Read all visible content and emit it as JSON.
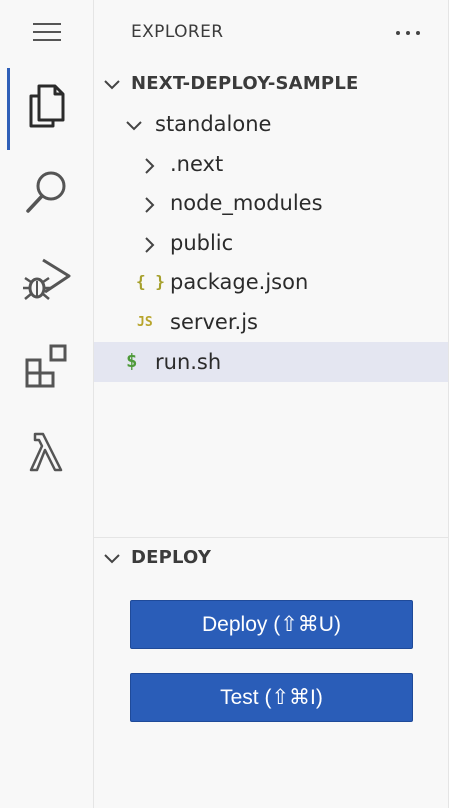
{
  "activity_bar": {
    "items": [
      {
        "name": "menu-icon"
      },
      {
        "name": "explorer-icon",
        "active": true
      },
      {
        "name": "search-icon"
      },
      {
        "name": "run-debug-icon"
      },
      {
        "name": "extensions-icon"
      },
      {
        "name": "lambda-icon"
      }
    ]
  },
  "explorer": {
    "title": "EXPLORER",
    "more_icon": "ellipsis-icon"
  },
  "project": {
    "name": "NEXT-DEPLOY-SAMPLE",
    "tree": [
      {
        "label": "standalone",
        "type": "folder",
        "expanded": true
      },
      {
        "label": ".next",
        "type": "folder",
        "expanded": false
      },
      {
        "label": "node_modules",
        "type": "folder",
        "expanded": false
      },
      {
        "label": "public",
        "type": "folder",
        "expanded": false
      },
      {
        "label": "package.json",
        "type": "json",
        "icon_text": "{ }"
      },
      {
        "label": "server.js",
        "type": "js",
        "icon_text": "JS"
      },
      {
        "label": "run.sh",
        "type": "shell",
        "icon_text": "$",
        "selected": true
      }
    ]
  },
  "deploy": {
    "title": "DEPLOY",
    "deploy_button": "Deploy (⇧⌘U)",
    "test_button": "Test (⇧⌘I)"
  },
  "colors": {
    "accent": "#2a5db8",
    "json_icon": "#a6a02c",
    "js_icon": "#b8a52c",
    "shell_icon": "#4e9a3a",
    "selected_row": "#e4e6f1"
  }
}
